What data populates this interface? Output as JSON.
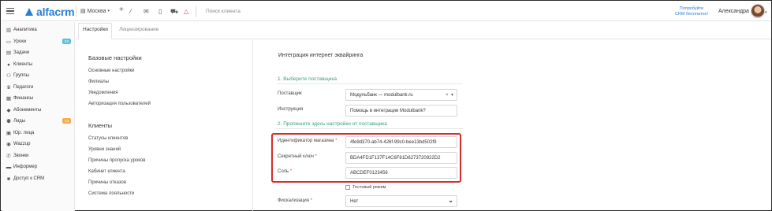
{
  "topbar": {
    "logo_text": "alfacrm",
    "city": "Москва",
    "city_caret": "▾",
    "search_placeholder": "Поиск клиента",
    "promo_line1": "Попробуйте",
    "promo_line2": "CRM бесплатно!",
    "user_name": "Александра",
    "user_caret": "▾",
    "icons": [
      "plus-icon",
      "wand-icon",
      "mail-icon",
      "phone-icon",
      "cart-icon",
      "alert-icon"
    ]
  },
  "sidebar": {
    "items": [
      {
        "label": "Аналитика",
        "icon": "chart-icon"
      },
      {
        "label": "Уроки",
        "icon": "calendar-icon",
        "badge": "52",
        "badge_color": "#5bc0de"
      },
      {
        "label": "Задачи",
        "icon": "tasks-icon"
      },
      {
        "label": "Клиенты",
        "icon": "user-icon"
      },
      {
        "label": "Группы",
        "icon": "group-icon"
      },
      {
        "label": "Педагоги",
        "icon": "teacher-icon"
      },
      {
        "label": "Финансы",
        "icon": "money-icon"
      },
      {
        "label": "Абонементы",
        "icon": "tag-icon"
      },
      {
        "label": "Лиды",
        "icon": "leads-icon",
        "badge": "13",
        "badge_color": "#f0ad4e"
      },
      {
        "label": "Юр. лица",
        "icon": "building-icon"
      },
      {
        "label": "Wazzup",
        "icon": "whatsapp-icon"
      },
      {
        "label": "Звонки",
        "icon": "phone-icon"
      },
      {
        "label": "Информер",
        "icon": "informer-icon"
      },
      {
        "label": "Доступ к CRM",
        "icon": "lock-icon"
      }
    ]
  },
  "tabs": [
    {
      "label": "Настройки",
      "active": true
    },
    {
      "label": "Лицензирование",
      "active": false
    }
  ],
  "settings": {
    "basic_title": "Базовые настройки",
    "basic_links": [
      "Основные настройки",
      "Филиалы",
      "Уведомления",
      "Авторизация пользователей"
    ],
    "clients_title": "Клиенты",
    "clients_links": [
      "Статусы клиентов",
      "Уровни знаний",
      "Причины пропуска уроков",
      "Кабинет клиента",
      "Причины отказов",
      "Система лояльности"
    ]
  },
  "panel": {
    "title": "Интеграция интернет эквайринга",
    "step1": "1. Выберите поставщика",
    "provider_label": "Поставщик",
    "provider_value": "Модульбанк — modulbank.ru",
    "provider_clear": "×",
    "provider_caret": "▾",
    "instruction_label": "Инструкция",
    "instruction_value": "Помощь в интеграции Modulbank?",
    "step2": "2. Пропишите здесь настройки от поставщика",
    "shop_id_label": "Идентификатор магазина",
    "shop_id_value": "4fe9d370-ab74-426f-99c0-bee13bd502f9",
    "secret_label": "Секретный ключ",
    "secret_value": "BDA4FD1F137F14C6F81D6273720922D2",
    "salt_label": "Соль",
    "salt_value": "ABCDEF0123456",
    "required_mark": "*",
    "test_mode_label": "Тестовый режим",
    "fiscal_label": "Фискализация",
    "fiscal_value": "Нет",
    "fiscal_caret": "⌄"
  },
  "colors": {
    "accent": "#2a7fd4",
    "step_green": "#3aa07c",
    "highlight_red": "#d62b2b"
  }
}
